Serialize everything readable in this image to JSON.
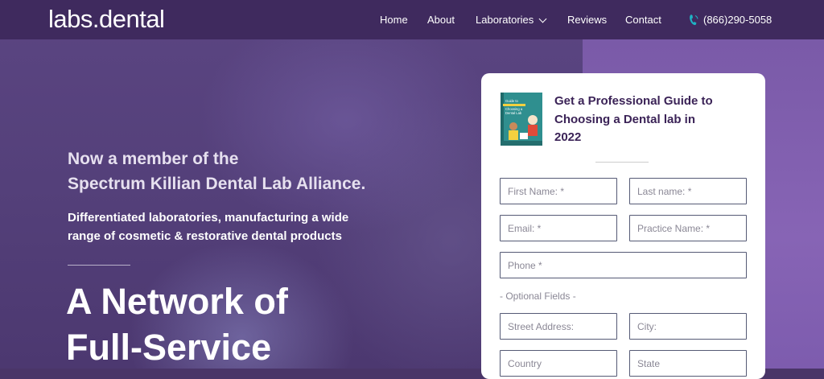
{
  "nav": {
    "logo": "labs.dental",
    "items": [
      "Home",
      "About",
      "Laboratories",
      "Reviews",
      "Contact"
    ],
    "phone": "(866)290-5058"
  },
  "hero": {
    "member_line1": "Now a member of the",
    "member_line2": "Spectrum Killian Dental Lab Alliance.",
    "sub_line1": "Differentiated laboratories, manufacturing a wide",
    "sub_line2": "range of cosmetic & restorative dental products",
    "headline_line1": "A Network of",
    "headline_line2": "Full-Service"
  },
  "form": {
    "title_line1": "Get a Professional Guide to",
    "title_line2": "Choosing a Dental lab in",
    "title_line3": "2022",
    "book_text": "Guide to Choosing a Dental Lab",
    "placeholders": {
      "first_name": "First Name: *",
      "last_name": "Last name: *",
      "email": "Email: *",
      "practice": "Practice Name: *",
      "phone": "Phone *",
      "street": "Street Address:",
      "city": "City:",
      "country": "Country",
      "state": "State"
    },
    "optional_label": "- Optional Fields -"
  },
  "colors": {
    "nav_bg": "#3f2a5e",
    "title_purple": "#3b2357",
    "phone_icon": "#1fb3c4"
  }
}
